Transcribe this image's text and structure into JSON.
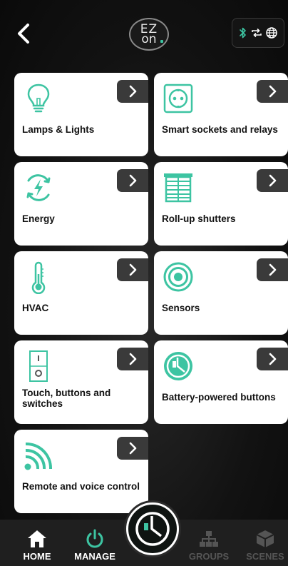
{
  "header": {
    "logo_top": "EZ",
    "logo_bottom": "on"
  },
  "categories": [
    {
      "label": "Lamps & Lights",
      "icon": "lightbulb-icon"
    },
    {
      "label": "Smart sockets and relays",
      "icon": "socket-icon"
    },
    {
      "label": "Energy",
      "icon": "energy-icon"
    },
    {
      "label": "Roll-up shutters",
      "icon": "shutter-icon"
    },
    {
      "label": "HVAC",
      "icon": "thermometer-icon"
    },
    {
      "label": "Sensors",
      "icon": "sensor-icon"
    },
    {
      "label": "Touch, buttons and switches",
      "icon": "switch-icon"
    },
    {
      "label": "Battery-powered buttons",
      "icon": "battery-button-icon"
    },
    {
      "label": "Remote and voice control",
      "icon": "remote-signal-icon"
    }
  ],
  "nav": {
    "home": "HOME",
    "manage": "MANAGE",
    "groups": "GROUPS",
    "scenes": "SCENES"
  },
  "colors": {
    "accent": "#3dc4a2",
    "card": "#ffffff",
    "background": "#121212",
    "arrow_bg": "#3a3a3a"
  }
}
